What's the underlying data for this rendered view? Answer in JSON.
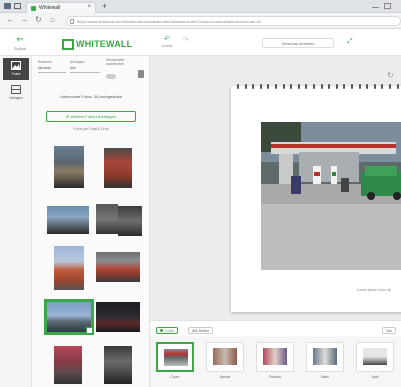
{
  "browser": {
    "tab_title": "Whitewall",
    "tab_close": "×",
    "new_tab": "+",
    "url": "https://www.whitewall.de/fotokalender/wandkalender/calendar-editor?product=wandkalender&format=a3"
  },
  "header": {
    "back_label": "Zurück",
    "brand": "WHITEWALL",
    "undo_label": "Zurück",
    "preview_label": "Vorschau ansehen"
  },
  "rail": {
    "photos_label": "Fotos",
    "layouts_label": "Vorlagen"
  },
  "panel": {
    "sort_label": "Sortieren",
    "sort_value": "Neueste",
    "show_label": "Anzeigen",
    "show_value": "Alle",
    "used_label": "Verwendete ausblenden",
    "notice": "Unbenutzte Fotos: 34 hochgeladen",
    "add_button": "Weitere Fotos hinzufügen",
    "add_sub": "Fotos per Drag & Drop"
  },
  "canvas": {
    "caption": "Lorem ipsum dolor sit"
  },
  "strip": {
    "tabs": [
      {
        "label": "Cover",
        "active": true
      },
      {
        "label": "Alle Seiten",
        "active": false
      }
    ],
    "right_label": "Jan",
    "thumbs": [
      {
        "label": "Cover",
        "selected": true
      },
      {
        "label": "Januar",
        "selected": false
      },
      {
        "label": "Februar",
        "selected": false
      },
      {
        "label": "März",
        "selected": false
      },
      {
        "label": "April",
        "selected": false
      }
    ]
  },
  "colors": {
    "accent": "#3aa845",
    "rail_active": "#444444"
  },
  "icons": [
    "back-arrow-icon",
    "undo-icon",
    "redo-icon",
    "fullscreen-icon",
    "photos-icon",
    "layouts-icon",
    "trash-icon",
    "plus-icon",
    "checkmark-icon"
  ]
}
